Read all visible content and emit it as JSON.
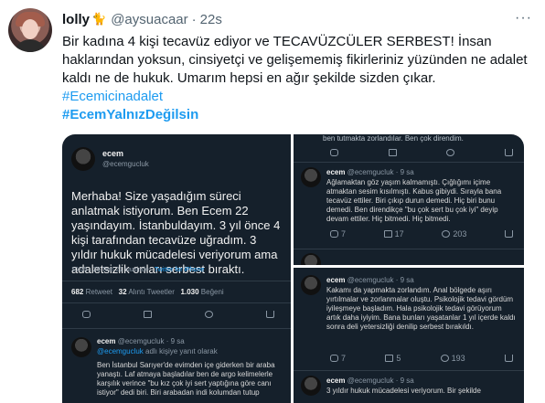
{
  "tweet": {
    "display_name": "lolly",
    "name_emoji": "🐈",
    "handle": "@aysuacaar",
    "separator": "·",
    "time": "22s",
    "more": "···",
    "body": "Bir kadına 4 kişi tecavüz ediyor ve TECAVÜZCÜLER SERBEST! İnsan haklarından yoksun, cinsiyetçi ve gelişememiş fikirleriniz yüzünden ne adalet kaldı ne de hukuk. Umarım hepsi en ağır şekilde sizden çıkar.",
    "hashtags": [
      "#Ecemicinadalet",
      "#EcemYalnızDeğilsin"
    ]
  },
  "media": {
    "left": {
      "name": "ecem",
      "handle": "@ecemgucluk",
      "main_text": "Merhaba! Size yaşadığım süreci anlatmak istiyorum. Ben Ecem 22 yaşındayım. İstanbuldayım. 3 yıl önce 4 kişi tarafından tecavüze uğradım. 3 yıldır hukuk mücadelesi veriyorum ama adaletsizlik onları serbest bıraktı.",
      "meta_time": "10:05 · 25 Tem 21 saatinde ·",
      "meta_source": "Twitter for iPhone",
      "stats_rt_num": "682",
      "stats_rt_label": "Retweet",
      "stats_quote_num": "32",
      "stats_quote_label": "Alıntı Tweetler",
      "stats_like_num": "1.030",
      "stats_like_label": "Beğeni",
      "reply_name": "ecem",
      "reply_handle": "@ecemgucluk · 9 sa",
      "reply_to_handle": "@ecemgucluk",
      "reply_to_suffix": "adlı kişiye yanıt olarak",
      "reply_text": "Ben İstanbul Sarıyer'de evimden içe giderken bir araba yanaştı. Laf atmaya başladılar ben de argo kelimelerle karşılık verince \"bu kız çok iyi sert yaptığına göre canı istiyor\" dedi biri. Biri arabadan indi kolumdan tutup"
    },
    "right_top": {
      "top_text": "ben tutmakta zorlandılar. Ben çok direndim.",
      "name": "ecem",
      "handle": "@ecemgucluk · 9 sa",
      "text": "Ağlamaktan göz yaşım kalmamıştı. Çığlığımı içime atmaktan sesim kısılmıştı. Kabus gibiydi. Sırayla bana tecavüz ettiler. Biri çıkıp durun demedi. Hiç biri bunu demedi. Ben direndikçe \"bu çok sert bu çok iyi\" deyip devam ettiler. Hiç bitmedi. Hiç bitmedi.",
      "counts": {
        "reply": "7",
        "retweet": "17",
        "like": "203"
      }
    },
    "right_bottom": {
      "name": "ecem",
      "handle": "@ecemgucluk · 9 sa",
      "text": "Kakamı da yapmakta zorlandım. Anal bölgede aşırı yırtılmalar ve zorlanmalar oluştu. Psikolojik tedavi gördüm iyileşmeye başladım. Hala psikolojik tedavi görüyorum artık daha iyiyim. Bana bunları yaşatanlar 1 yıl içerde kaldı sonra deli yetersizliği denilip serbest bırakıldı.",
      "counts": {
        "reply": "7",
        "retweet": "5",
        "like": "193"
      },
      "bottom_name": "ecem",
      "bottom_handle": "@ecemgucluk · 9 sa",
      "bottom_text": "3 yıldır hukuk mücadelesi veriyorum. Bir şekilde"
    }
  }
}
